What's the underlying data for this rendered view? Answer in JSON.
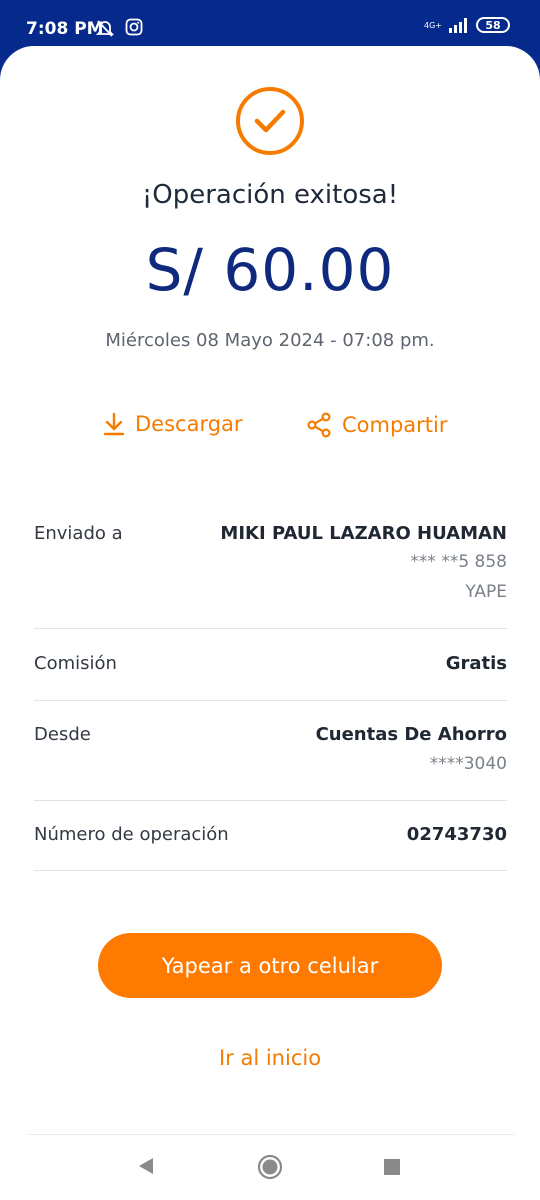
{
  "status_bar": {
    "time": "7:08 PM",
    "network": "4G+",
    "battery": "58"
  },
  "receipt": {
    "title": "¡Operación exitosa!",
    "amount": "S/ 60.00",
    "datetime": "Miércoles 08 Mayo 2024 - 07:08 pm."
  },
  "actions": {
    "download": "Descargar",
    "share": "Compartir"
  },
  "details": {
    "sent_to": {
      "label": "Enviado a",
      "name": "MIKI PAUL LAZARO HUAMAN",
      "phone": "*** **5 858",
      "app": "YAPE"
    },
    "commission": {
      "label": "Comisión",
      "value": "Gratis"
    },
    "from": {
      "label": "Desde",
      "account": "Cuentas De Ahorro",
      "number": "****3040"
    },
    "operation": {
      "label": "Número de operación",
      "value": "02743730"
    }
  },
  "buttons": {
    "primary": "Yapear a otro celular",
    "home": "Ir al inicio"
  },
  "colors": {
    "brand_blue": "#062a8c",
    "accent_orange": "#ff7a00"
  }
}
